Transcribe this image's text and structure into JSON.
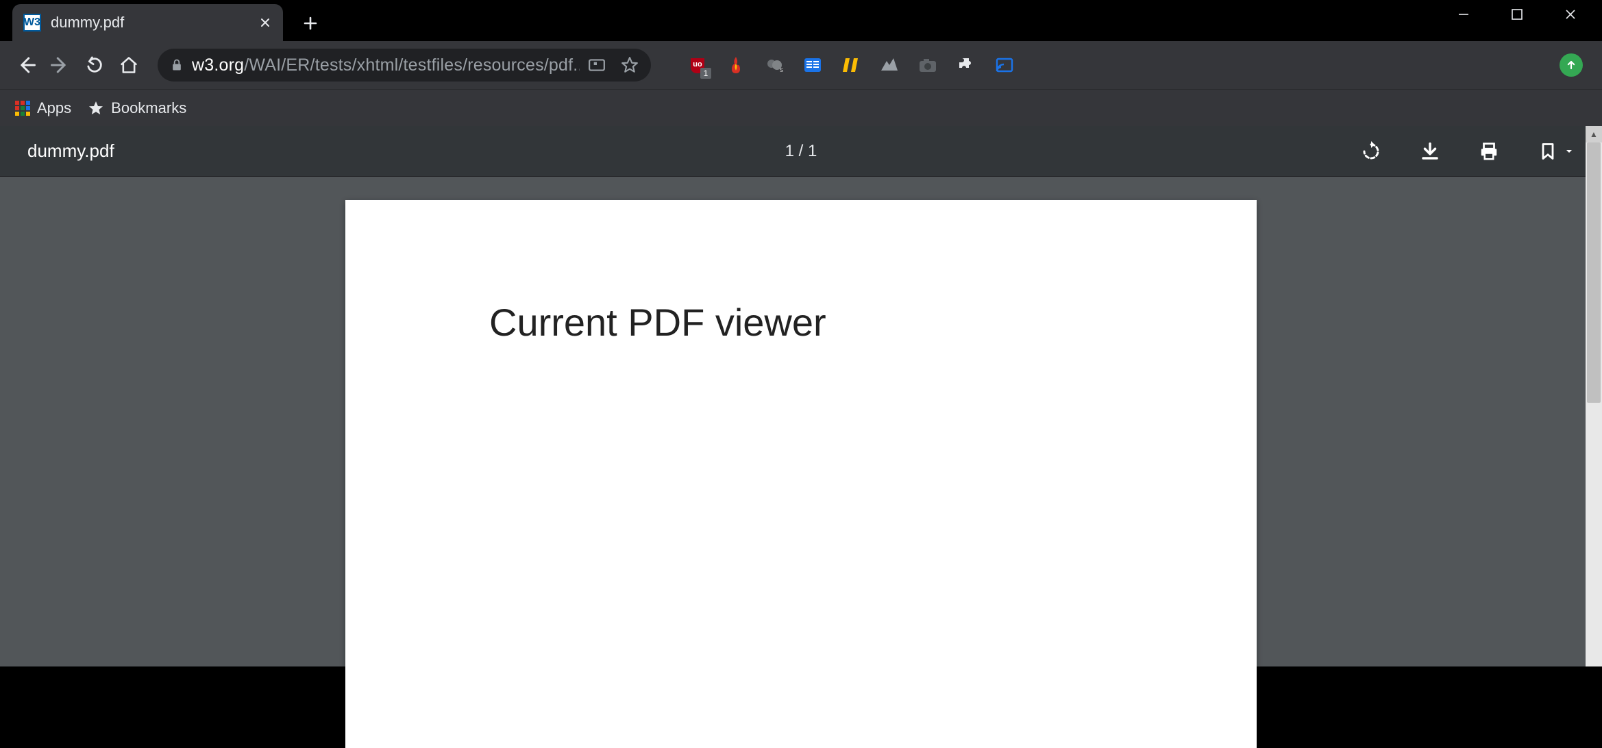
{
  "window": {
    "minimize": "—",
    "maximize": "□",
    "close": "✕"
  },
  "tab": {
    "title": "dummy.pdf",
    "favicon_text": "W3"
  },
  "nav": {
    "url_primary": "w3.org",
    "url_secondary": "/WAI/ER/tests/xhtml/testfiles/resources/pdf..."
  },
  "extensions": {
    "ublock_badge": "1"
  },
  "bookmarks_bar": {
    "apps": "Apps",
    "bookmarks": "Bookmarks"
  },
  "pdf": {
    "filename": "dummy.pdf",
    "page_indicator": "1 / 1",
    "content_heading": "Current PDF viewer"
  }
}
